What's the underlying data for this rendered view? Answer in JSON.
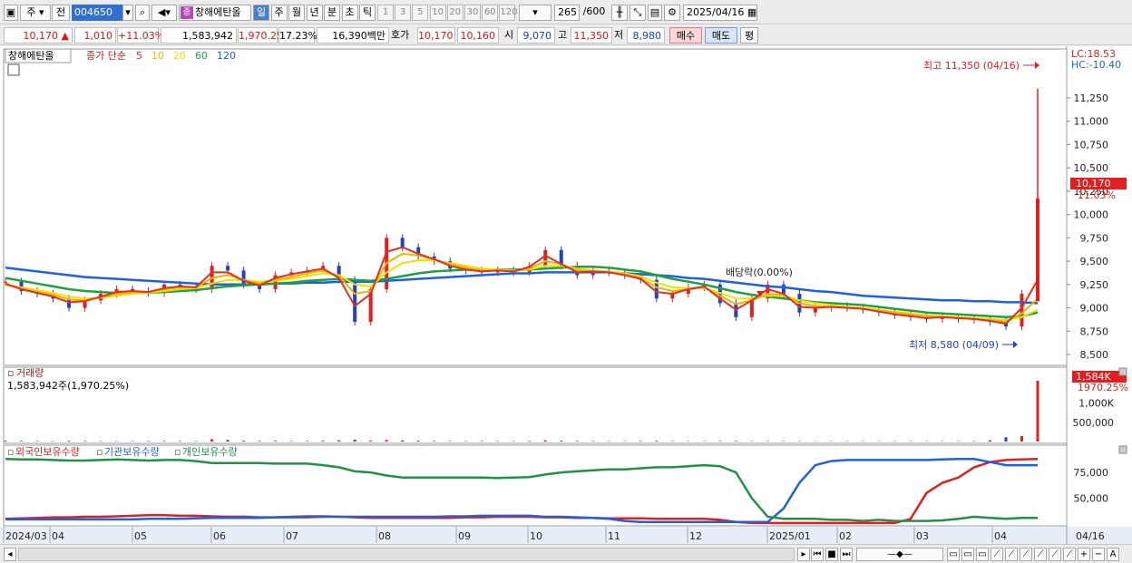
{
  "toolbar": {
    "period_label": "주",
    "prev_label": "전",
    "stock_code": "004650",
    "stock_badge": "종",
    "stock_name": "창해에탄올",
    "intervals": [
      "일",
      "주",
      "월",
      "년",
      "분",
      "초",
      "틱"
    ],
    "active_interval": "일",
    "minute_options": [
      "1",
      "3",
      "5",
      "10",
      "20",
      "30",
      "60",
      "120"
    ],
    "count": "265",
    "count_total": "/600",
    "date": "2025/04/16"
  },
  "infobar": {
    "price": "10,170",
    "arrow": "▲",
    "change": "1,010",
    "change_pct": "+11.03%",
    "volume": "1,583,942",
    "volume_pct": "1,970.25%",
    "turnover": "17.23%",
    "amount": "16,390백만",
    "bid_label": "호가",
    "bid_price": "10,170",
    "ask_price": "10,160",
    "open_label": "시",
    "open_price": "9,070",
    "high_label": "고",
    "high_price": "11,350",
    "low_label": "저",
    "low_price": "8,980",
    "buy_label": "매수",
    "sell_label": "매도",
    "eval_label": "평"
  },
  "price_panel": {
    "legend_name": "창해에탄올",
    "legend_ma_label": "종가 단순",
    "ma_periods": [
      "5",
      "10",
      "20",
      "60",
      "120"
    ],
    "ma_colors": [
      "#e03020",
      "#f0b400",
      "#f0e000",
      "#20a040",
      "#2060e0"
    ],
    "lc_label": "LC:18.53",
    "hc_label": "HC:-10.40",
    "high_annotation": "최고 11,350 (04/16)",
    "low_annotation": "최저 8,580 (04/09)",
    "mid_annotation": "배당락(0.00%)",
    "last_price_tag": "10,170",
    "last_pct_tag": "11.03%",
    "y_ticks": [
      "11,250",
      "11,000",
      "10,750",
      "10,500",
      "10,250",
      "10,000",
      "9,750",
      "9,500",
      "9,250",
      "9,000",
      "8,750",
      "8,500"
    ]
  },
  "volume_panel": {
    "title": "거래량",
    "summary": "1,583,942주(1,970.25%)",
    "last_tag": "1,584K",
    "last_pct": "1970.25%",
    "y_ticks": [
      "1,000K",
      "500,000"
    ]
  },
  "holding_panel": {
    "series_labels": [
      "외국인보유수량",
      "기관보유수량",
      "개인보유수량"
    ],
    "y_ticks": [
      "75,000",
      "50,000"
    ]
  },
  "x_axis": {
    "labels": [
      "2024/03",
      "04",
      "05",
      "06",
      "07",
      "08",
      "09",
      "10",
      "11",
      "12",
      "2025/01",
      "02",
      "03",
      "04",
      "04/16"
    ]
  },
  "chart_data": [
    {
      "type": "line",
      "title": "창해에탄올",
      "series": [
        {
          "name": "종가",
          "values": [
            9280,
            9180,
            9150,
            9100,
            9000,
            9080,
            9150,
            9200,
            9180,
            9160,
            9250,
            9230,
            9200,
            9450,
            9400,
            9250,
            9200,
            9350,
            9380,
            9400,
            9450,
            9300,
            8850,
            9200,
            9750,
            9650,
            9550,
            9500,
            9420,
            9400,
            9380,
            9400,
            9380,
            9450,
            9620,
            9450,
            9350,
            9400,
            9380,
            9350,
            9300,
            9100,
            9150,
            9220,
            9250,
            9050,
            8900,
            9100,
            9250,
            9150,
            8950,
            9000,
            9020,
            9000,
            8980,
            8950,
            8920,
            8900,
            8880,
            8900,
            8880,
            8870,
            8850,
            8800,
            9150,
            10170
          ]
        },
        {
          "name": "5",
          "values": [
            9260,
            9200,
            9160,
            9120,
            9060,
            9070,
            9120,
            9170,
            9180,
            9170,
            9210,
            9230,
            9220,
            9380,
            9380,
            9290,
            9240,
            9320,
            9360,
            9390,
            9420,
            9320,
            9020,
            9150,
            9600,
            9650,
            9580,
            9520,
            9450,
            9410,
            9390,
            9400,
            9390,
            9440,
            9560,
            9470,
            9380,
            9390,
            9380,
            9350,
            9310,
            9170,
            9150,
            9200,
            9230,
            9100,
            8980,
            9080,
            9200,
            9150,
            9010,
            9000,
            9010,
            9000,
            8990,
            8960,
            8930,
            8910,
            8890,
            8900,
            8890,
            8880,
            8860,
            8830,
            9000,
            9300
          ]
        },
        {
          "name": "10",
          "values": [
            9250,
            9210,
            9170,
            9140,
            9090,
            9080,
            9110,
            9150,
            9170,
            9170,
            9200,
            9220,
            9220,
            9320,
            9350,
            9300,
            9260,
            9300,
            9330,
            9370,
            9400,
            9340,
            9150,
            9180,
            9480,
            9580,
            9560,
            9520,
            9470,
            9430,
            9400,
            9400,
            9390,
            9420,
            9500,
            9470,
            9400,
            9390,
            9380,
            9360,
            9320,
            9220,
            9180,
            9200,
            9220,
            9130,
            9040,
            9080,
            9150,
            9140,
            9050,
            9020,
            9010,
            9000,
            8990,
            8970,
            8950,
            8930,
            8910,
            8900,
            8890,
            8880,
            8870,
            8850,
            8940,
            9100
          ]
        },
        {
          "name": "20",
          "values": [
            9240,
            9220,
            9190,
            9160,
            9120,
            9100,
            9110,
            9130,
            9150,
            9160,
            9180,
            9200,
            9210,
            9260,
            9300,
            9300,
            9280,
            9290,
            9310,
            9340,
            9370,
            9350,
            9250,
            9230,
            9380,
            9480,
            9510,
            9510,
            9480,
            9450,
            9420,
            9410,
            9400,
            9410,
            9450,
            9450,
            9420,
            9400,
            9390,
            9370,
            9340,
            9270,
            9220,
            9210,
            9210,
            9160,
            9100,
            9100,
            9130,
            9130,
            9080,
            9050,
            9030,
            9010,
            9000,
            8980,
            8960,
            8940,
            8920,
            8910,
            8900,
            8890,
            8880,
            8870,
            8900,
            8980
          ]
        },
        {
          "name": "60",
          "values": [
            9320,
            9290,
            9260,
            9230,
            9200,
            9180,
            9170,
            9160,
            9160,
            9160,
            9170,
            9180,
            9190,
            9210,
            9230,
            9240,
            9250,
            9260,
            9270,
            9290,
            9300,
            9310,
            9300,
            9290,
            9310,
            9340,
            9370,
            9390,
            9400,
            9410,
            9410,
            9410,
            9410,
            9410,
            9420,
            9430,
            9440,
            9440,
            9430,
            9410,
            9390,
            9350,
            9310,
            9280,
            9250,
            9210,
            9170,
            9140,
            9120,
            9100,
            9080,
            9060,
            9050,
            9040,
            9030,
            9010,
            8990,
            8970,
            8950,
            8940,
            8930,
            8920,
            8910,
            8900,
            8910,
            8950
          ]
        },
        {
          "name": "120",
          "values": [
            9430,
            9410,
            9390,
            9370,
            9350,
            9330,
            9320,
            9310,
            9300,
            9290,
            9280,
            9270,
            9260,
            9250,
            9250,
            9250,
            9250,
            9260,
            9260,
            9270,
            9270,
            9280,
            9280,
            9280,
            9290,
            9300,
            9310,
            9320,
            9330,
            9340,
            9350,
            9360,
            9370,
            9370,
            9380,
            9380,
            9380,
            9380,
            9380,
            9370,
            9360,
            9350,
            9340,
            9320,
            9310,
            9290,
            9270,
            9250,
            9230,
            9220,
            9200,
            9180,
            9170,
            9150,
            9130,
            9120,
            9110,
            9100,
            9090,
            9080,
            9080,
            9070,
            9070,
            9060,
            9060,
            9050
          ]
        }
      ],
      "ylim": [
        8450,
        11350
      ]
    },
    {
      "type": "bar",
      "title": "거래량",
      "series": [
        {
          "name": "거래량",
          "values": [
            20000,
            15000,
            12000,
            10000,
            18000,
            14000,
            12000,
            11000,
            10000,
            12000,
            15000,
            12000,
            10000,
            60000,
            40000,
            20000,
            15000,
            18000,
            12000,
            14000,
            20000,
            30000,
            45000,
            25000,
            40000,
            30000,
            20000,
            15000,
            12000,
            10000,
            12000,
            11000,
            10000,
            15000,
            30000,
            20000,
            15000,
            12000,
            10000,
            9000,
            12000,
            18000,
            12000,
            10000,
            9000,
            12000,
            15000,
            10000,
            12000,
            10000,
            9000,
            8000,
            8000,
            9000,
            8000,
            7000,
            9000,
            8000,
            7000,
            8000,
            9000,
            10000,
            30000,
            110000,
            140000,
            1583942
          ]
        }
      ],
      "ylim": [
        0,
        1700000
      ]
    },
    {
      "type": "line",
      "series": [
        {
          "name": "외국인보유수량",
          "values": [
            30000,
            30500,
            31000,
            31500,
            31500,
            32000,
            32000,
            32500,
            33000,
            33500,
            33500,
            33000,
            33000,
            32500,
            32000,
            32000,
            31500,
            31500,
            32000,
            32500,
            32500,
            32000,
            31500,
            31000,
            31000,
            31000,
            31000,
            31000,
            31000,
            31500,
            31500,
            32000,
            32000,
            32000,
            31500,
            31500,
            31000,
            31000,
            30500,
            30500,
            30500,
            30000,
            30000,
            30000,
            30000,
            29000,
            27000,
            26000,
            26000,
            26000,
            26000,
            26000,
            26000,
            26000,
            26000,
            26000,
            26000,
            30000,
            55000,
            65000,
            70000,
            80000,
            85000,
            87000,
            87500,
            88000
          ]
        },
        {
          "name": "기관보유수량",
          "values": [
            29500,
            29500,
            29500,
            29500,
            29500,
            29500,
            29500,
            29500,
            29500,
            30000,
            30000,
            30000,
            30500,
            31000,
            31000,
            31000,
            31000,
            31500,
            31500,
            31500,
            32000,
            32000,
            32000,
            32000,
            32000,
            32000,
            32000,
            32000,
            32500,
            32500,
            33000,
            33000,
            33000,
            33000,
            32000,
            32000,
            31500,
            31000,
            30000,
            28000,
            27000,
            27000,
            27000,
            27000,
            27000,
            27000,
            27000,
            27000,
            27000,
            40000,
            65000,
            82000,
            86000,
            87000,
            87000,
            87000,
            87000,
            87000,
            87000,
            87500,
            88000,
            88000,
            85000,
            82000,
            82000,
            82000
          ]
        },
        {
          "name": "개인보유수량",
          "values": [
            88000,
            87500,
            87500,
            87000,
            86500,
            86500,
            87000,
            87500,
            87000,
            86500,
            87000,
            87000,
            86000,
            84000,
            84000,
            84000,
            84000,
            83500,
            83500,
            83500,
            82000,
            80000,
            76000,
            75000,
            72000,
            70000,
            70000,
            70000,
            70000,
            70000,
            70000,
            69500,
            70000,
            70500,
            73000,
            75000,
            76000,
            77000,
            78000,
            78000,
            79000,
            80000,
            80000,
            81000,
            82000,
            81000,
            75000,
            50000,
            32000,
            30000,
            30000,
            30000,
            29000,
            29000,
            28000,
            29000,
            28000,
            28000,
            28000,
            28500,
            30000,
            32000,
            31000,
            30000,
            31000,
            31000
          ]
        }
      ],
      "ylim": [
        25000,
        90000
      ]
    }
  ]
}
